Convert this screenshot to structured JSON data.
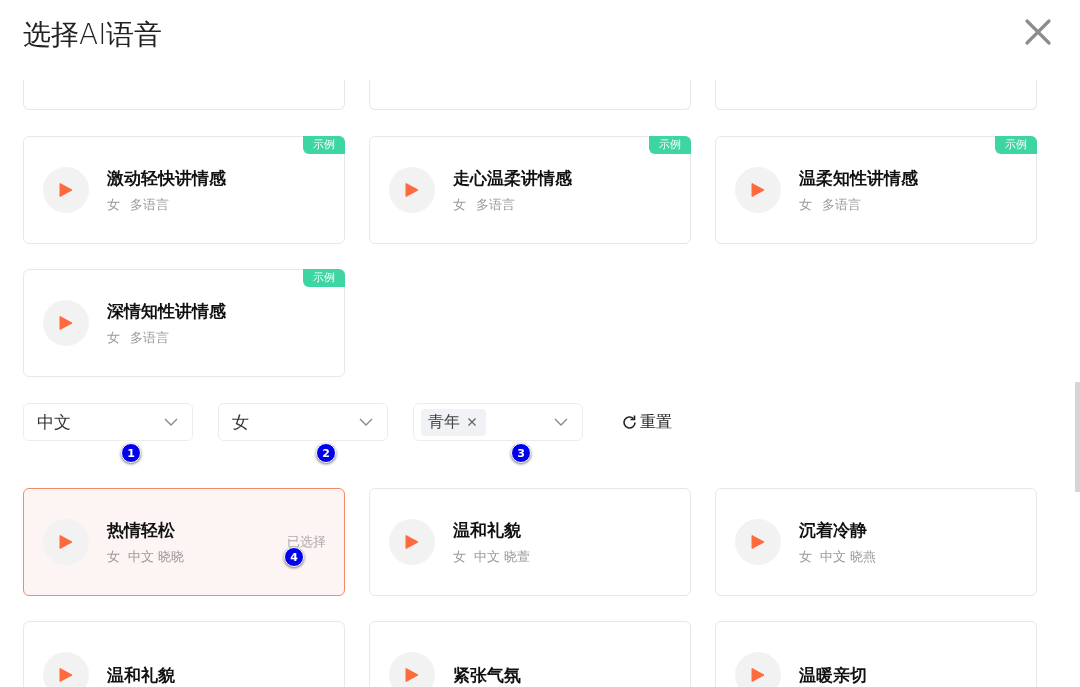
{
  "title": "选择AI语音",
  "top_cards": [
    {
      "kind": "cut"
    },
    {
      "kind": "cut"
    },
    {
      "kind": "cut"
    }
  ],
  "sample_cards": [
    {
      "name": "激动轻快讲情感",
      "gender": "女",
      "language": "多语言",
      "tag": "示例"
    },
    {
      "name": "走心温柔讲情感",
      "gender": "女",
      "language": "多语言",
      "tag": "示例"
    },
    {
      "name": "温柔知性讲情感",
      "gender": "女",
      "language": "多语言",
      "tag": "示例"
    },
    {
      "name": "深情知性讲情感",
      "gender": "女",
      "language": "多语言",
      "tag": "示例"
    }
  ],
  "filters": [
    {
      "kind": "text",
      "value": "中文",
      "marker": "1"
    },
    {
      "kind": "text",
      "value": "女",
      "marker": "2"
    },
    {
      "kind": "chip",
      "value": "青年",
      "marker": "3"
    }
  ],
  "reset_label": "重置",
  "voices": [
    {
      "name": "热情轻松",
      "sub": "女  中文 晓晓",
      "selected": true,
      "status": "已选择",
      "marker": "4"
    },
    {
      "name": "温和礼貌",
      "sub": "女  中文 晓萱",
      "selected": false
    },
    {
      "name": "沉着冷静",
      "sub": "女  中文 晓燕",
      "selected": false
    },
    {
      "name": "温和礼貌",
      "selected": false
    },
    {
      "name": "紧张气氛",
      "selected": false
    },
    {
      "name": "温暖亲切",
      "selected": false
    }
  ]
}
